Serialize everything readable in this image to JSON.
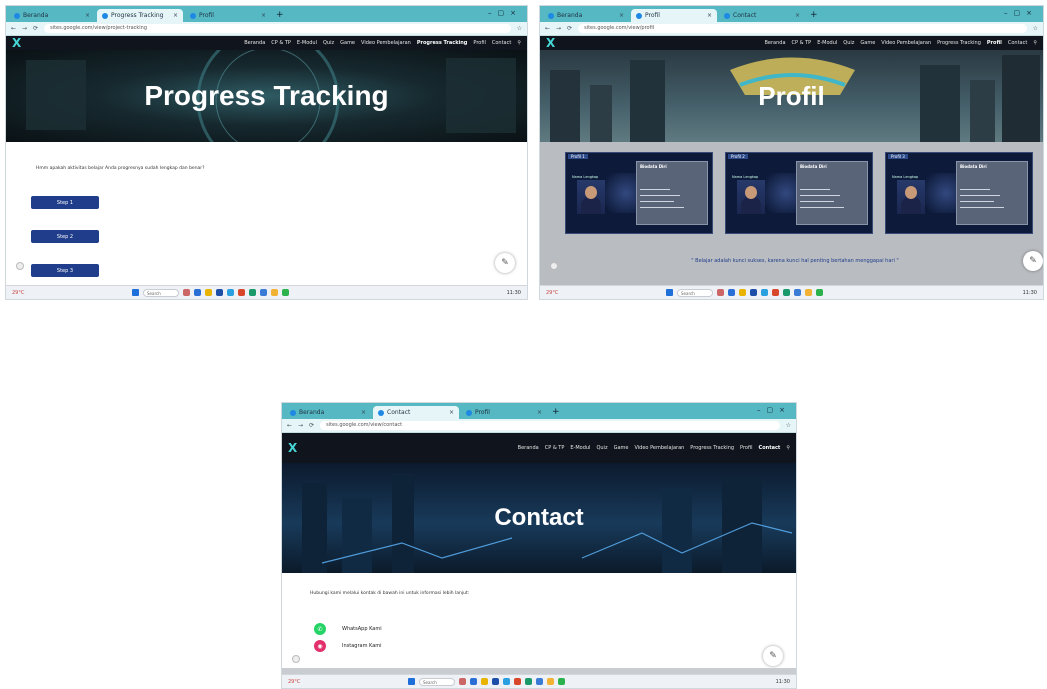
{
  "colors": {
    "accent": "#47d6d6",
    "button": "#1f3d8a",
    "tabbar": "#55b8c3",
    "whatsapp": "#25d366",
    "instagram": "#e1306c"
  },
  "nav": [
    "Beranda",
    "CP & TP",
    "E-Modul",
    "Quiz",
    "Game",
    "Video Pembelajaran",
    "Progress Tracking",
    "Profil",
    "Contact"
  ],
  "logo": "X",
  "s1": {
    "tabs": [
      "Beranda",
      "Progress Tracking",
      "Profil"
    ],
    "url": "sites.google.com/view/project-tracking",
    "hero_title": "Progress Tracking",
    "question": "Hmm apakah aktivitas belajar Anda progresnya sudah lengkap dan benar?",
    "steps": [
      "Step 1",
      "Step 2",
      "Step 3"
    ]
  },
  "s2": {
    "tabs": [
      "Beranda",
      "Profil",
      "Contact"
    ],
    "url": "sites.google.com/view/profil",
    "hero_title": "Profil",
    "cards": [
      {
        "label": "Profil 1",
        "name": "Nama Lengkap",
        "info_title": "Biodata Diri"
      },
      {
        "label": "Profil 2",
        "name": "Nama Lengkap",
        "info_title": "Biodata Diri"
      },
      {
        "label": "Profil 3",
        "name": "Nama Lengkap",
        "info_title": "Biodata Diri"
      }
    ],
    "quote": "\" Belajar adalah kunci sukses, karena kunci hal penting bertahan menggapai hari \""
  },
  "s3": {
    "tabs": [
      "Beranda",
      "Contact",
      "Profil"
    ],
    "url": "sites.google.com/view/contact",
    "hero_title": "Contact",
    "intro": "Hubungi kami melalui kontak di bawah ini untuk informasi lebih lanjut:",
    "contacts": [
      {
        "icon": "whatsapp-icon",
        "label": "WhatsApp Kami"
      },
      {
        "icon": "instagram-icon",
        "label": "Instagram Kami"
      }
    ]
  },
  "taskbar": {
    "weather": "29°C",
    "search": "Search",
    "time": "11:30",
    "date": "10/12/2024"
  }
}
